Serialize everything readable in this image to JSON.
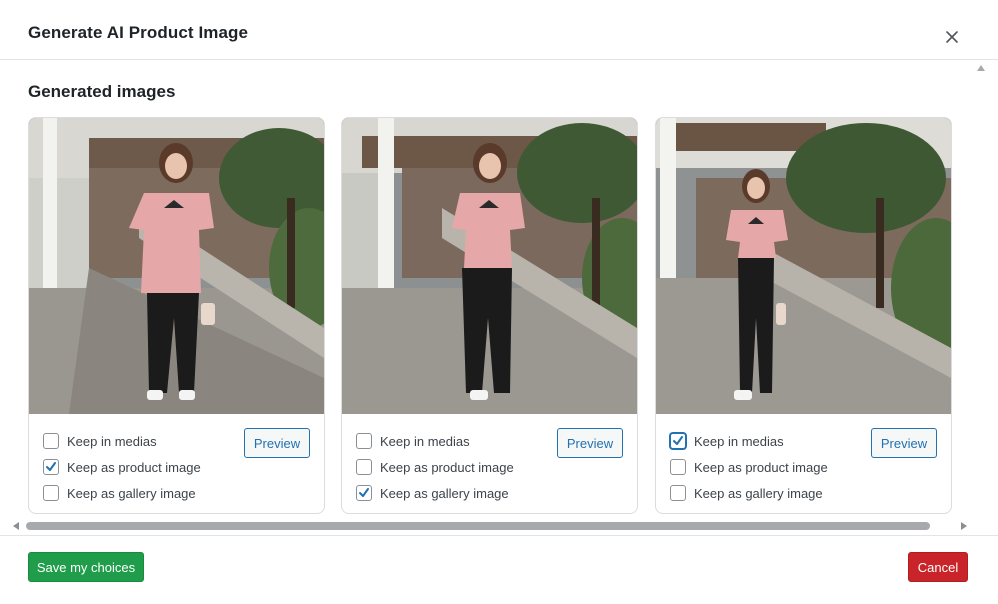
{
  "modal": {
    "title": "Generate AI Product Image",
    "close_icon": "close-icon"
  },
  "section": {
    "title": "Generated images"
  },
  "cards": [
    {
      "options": [
        {
          "label": "Keep in medias",
          "checked": false
        },
        {
          "label": "Keep as product image",
          "checked": true
        },
        {
          "label": "Keep as gallery image",
          "checked": false
        }
      ],
      "preview_label": "Preview"
    },
    {
      "options": [
        {
          "label": "Keep in medias",
          "checked": false
        },
        {
          "label": "Keep as product image",
          "checked": false
        },
        {
          "label": "Keep as gallery image",
          "checked": true
        }
      ],
      "preview_label": "Preview"
    },
    {
      "options": [
        {
          "label": "Keep in medias",
          "checked": true
        },
        {
          "label": "Keep as product image",
          "checked": false
        },
        {
          "label": "Keep as gallery image",
          "checked": false
        }
      ],
      "preview_label": "Preview"
    }
  ],
  "footer": {
    "save_label": "Save my choices",
    "cancel_label": "Cancel"
  },
  "colors": {
    "accent": "#2271b1",
    "save": "#1f9d4a",
    "cancel": "#c8242a"
  }
}
